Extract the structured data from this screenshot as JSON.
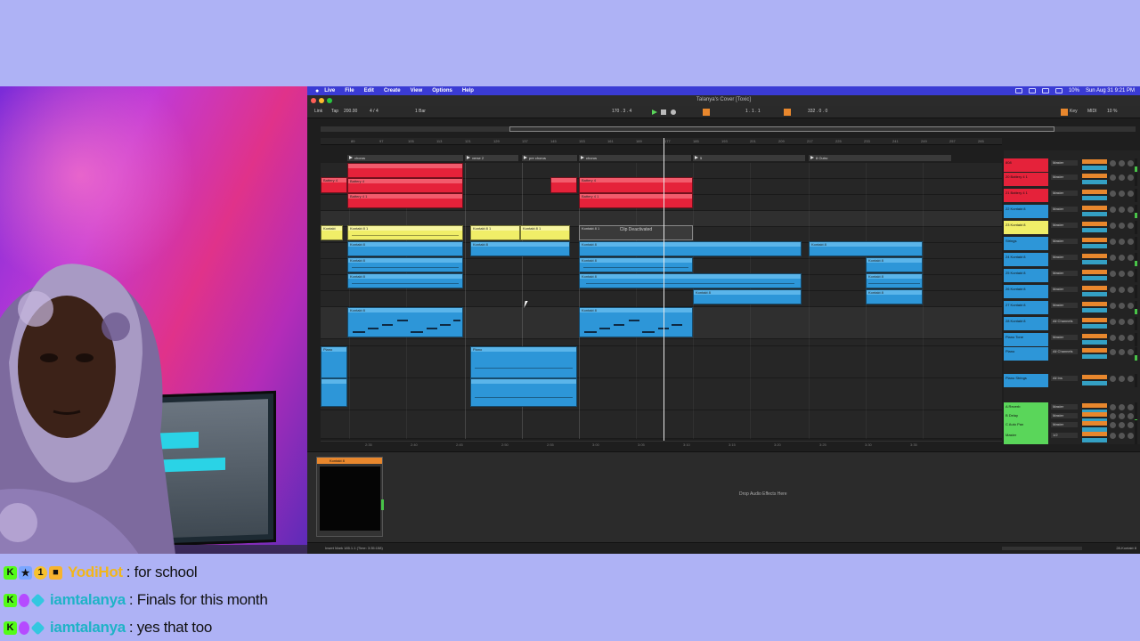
{
  "os_menu": {
    "app": "Live",
    "items": [
      "File",
      "Edit",
      "Create",
      "View",
      "Options",
      "Help"
    ],
    "clock": "Sun Aug 31  9:21 PM",
    "battery": "10%"
  },
  "window": {
    "title": "Talanya's Cover  [Toxic]"
  },
  "transport": {
    "link": "Link",
    "tap": "Tap",
    "tempo": "200.00",
    "time_sig": "4 / 4",
    "quantize": "1 Bar",
    "position": "170 .  3 .  4",
    "loop_start": "1 .  1 .  1",
    "loop_length": "332 .  0 .  0",
    "key_label": "Key",
    "midi_label": "MIDI",
    "cpu": "10 %"
  },
  "ruler_ticks": [
    "89",
    "97",
    "105",
    "113",
    "121",
    "129",
    "137",
    "145",
    "153",
    "161",
    "169",
    "177",
    "185",
    "193",
    "201",
    "209",
    "217",
    "225",
    "233",
    "241",
    "249",
    "257",
    "265"
  ],
  "locators": [
    {
      "label": "chorus"
    },
    {
      "label": "verse 2"
    },
    {
      "label": "pre chorus"
    },
    {
      "label": "chorus"
    },
    {
      "label": "5"
    },
    {
      "label": "8 Outro"
    }
  ],
  "clips": {
    "red_1": "Battery 4",
    "red_2": "Battery 4 1",
    "yellow_1": "Kontakt 8 1",
    "yellow_2": "Kontakt 8 1",
    "yellow_3": "Kontakt 8 1",
    "yellow_intro": "Kontakt",
    "blue_1": "Kontakt 8",
    "blue_2": "Kontakt 8",
    "strings": "Piano",
    "deactivated": "Clip Deactivated"
  },
  "timeline_ticks": [
    "2:35",
    "2:40",
    "2:45",
    "2:50",
    "2:55",
    "3:00",
    "3:05",
    "3:10",
    "3:15",
    "3:20",
    "3:25",
    "3:30",
    "3:35"
  ],
  "mixer": {
    "tracks": [
      {
        "name": "808",
        "color": "red",
        "out": "Master"
      },
      {
        "name": "20 Battery 4 1",
        "color": "red",
        "out": "Master"
      },
      {
        "name": "21 Battery 4 1",
        "color": "red",
        "out": "Master"
      },
      {
        "name": "22 Kontakt 8",
        "color": "blu",
        "out": "Master"
      },
      {
        "name": "23 Kontakt 8",
        "color": "yel",
        "out": "Master"
      },
      {
        "name": "Strings",
        "color": "blu",
        "out": "Master"
      },
      {
        "name": "24 Kontakt 8",
        "color": "blu",
        "out": "Master"
      },
      {
        "name": "25 Kontakt 8",
        "color": "blu",
        "out": "Master"
      },
      {
        "name": "26 Kontakt 8",
        "color": "blu",
        "out": "Master"
      },
      {
        "name": "27 Kontakt 8",
        "color": "blu",
        "out": "Master"
      },
      {
        "name": "28 Kontakt 8",
        "color": "blu",
        "out": "All Channels"
      },
      {
        "name": "Piano Tone",
        "color": "blu",
        "out": "Master"
      },
      {
        "name": "Piano",
        "color": "blu",
        "out": "All Channels"
      },
      {
        "name": "Piano Strings",
        "color": "blu",
        "out": "All Ins"
      },
      {
        "name": "A Reverb",
        "color": "grn",
        "out": "Master"
      },
      {
        "name": "B Delay",
        "color": "grn",
        "out": "Master"
      },
      {
        "name": "C Auto Pan",
        "color": "grn",
        "out": "Master"
      },
      {
        "name": "Master",
        "color": "grn",
        "out": "1/2"
      }
    ]
  },
  "device": {
    "name": "Kontakt 8",
    "drop_text": "Drop Audio Effects Here"
  },
  "status": {
    "left": "Insert Mark 185.1.1 (Time: 3:35:158)",
    "right": "28-Kontakt 8"
  },
  "chat": {
    "messages": [
      {
        "user": "YodiHot",
        "user_color": "#f2b61a",
        "text": ": for school",
        "badges": [
          "k",
          "b1",
          "b2",
          "b3"
        ]
      },
      {
        "user": "iamtalanya",
        "user_color": "#1fb3c7",
        "text": ": Finals for this month",
        "badges": [
          "k",
          "mic",
          "cube"
        ]
      },
      {
        "user": "iamtalanya",
        "user_color": "#1fb3c7",
        "text": ": yes that too",
        "badges": [
          "k",
          "mic",
          "cube"
        ]
      }
    ]
  },
  "colors": {
    "page_bg": "#aeb2f5",
    "clip_red": "#e5223a",
    "clip_yellow": "#f0ee68",
    "clip_blue": "#2d96d8",
    "return_green": "#5ad65a",
    "accent_orange": "#e8872d"
  }
}
